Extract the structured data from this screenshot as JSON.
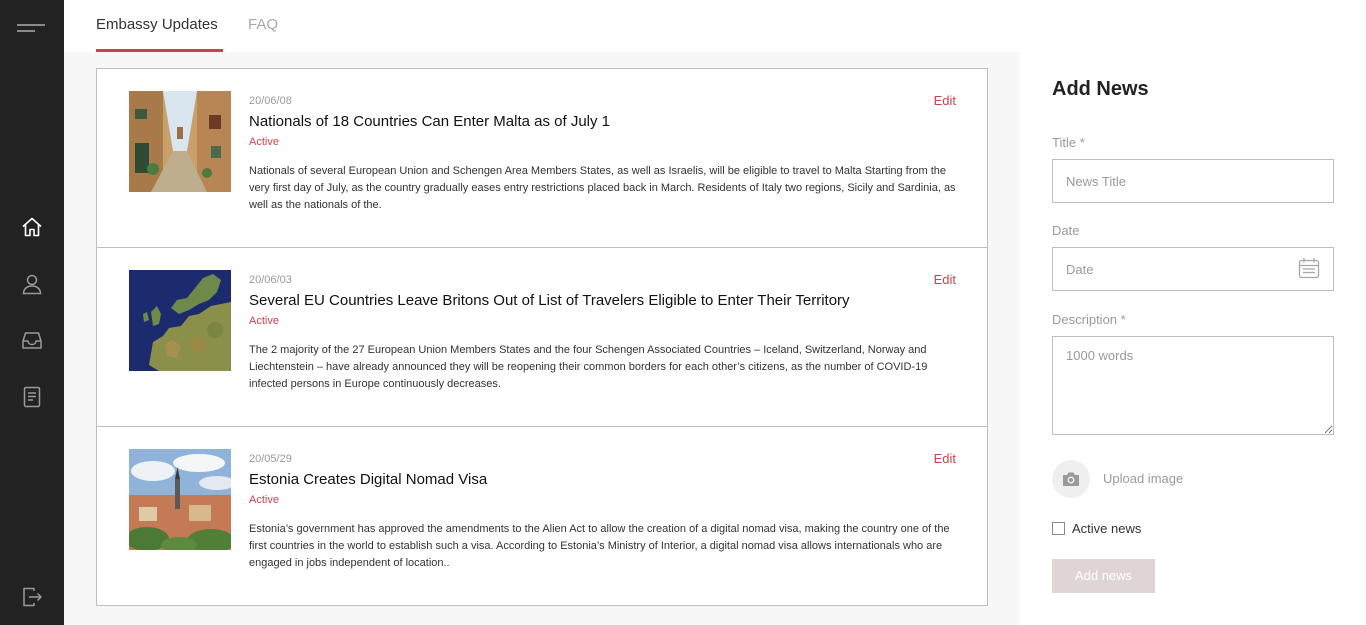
{
  "tabs": [
    {
      "label": "Embassy Updates",
      "active": true
    },
    {
      "label": "FAQ",
      "active": false
    }
  ],
  "sidebar": {
    "icons": [
      "menu-icon",
      "home-icon",
      "user-icon",
      "inbox-icon",
      "document-icon",
      "logout-icon"
    ]
  },
  "news": [
    {
      "date": "20/06/08",
      "title": "Nationals of 18 Countries Can Enter Malta as of July 1",
      "status": "Active",
      "description": "Nationals of several European Union and Schengen Area Members States, as well as Israelis, will be eligible to travel to Malta Starting from the very first day of July, as the country gradually eases entry restrictions placed back in March. Residents of Italy two regions, Sicily and Sardinia, as well as the nationals of the.",
      "edit": "Edit"
    },
    {
      "date": "20/06/03",
      "title": "Several EU Countries Leave Britons Out of List of Travelers Eligible to Enter Their Territory",
      "status": "Active",
      "description": "The 2 majority of the 27 European Union Members States and the four Schengen Associated Countries – Iceland, Switzerland, Norway and Liechtenstein – have already announced they will be reopening their common borders for each other’s citizens, as the number of COVID-19 infected persons in Europe continuously decreases.",
      "edit": "Edit"
    },
    {
      "date": "20/05/29",
      "title": "Estonia Creates Digital Nomad Visa",
      "status": "Active",
      "description": "Estonia’s government has approved the amendments to the Alien Act to allow the creation of a digital nomad visa, making the country one of the first countries in the world to establish such a visa. According to Estonia’s Ministry of Interior, a digital nomad visa allows internationals who are engaged in jobs independent of location..",
      "edit": "Edit"
    }
  ],
  "form": {
    "heading": "Add News",
    "title_label": "Title *",
    "title_placeholder": "News Title",
    "date_label": "Date",
    "date_placeholder": "Date",
    "description_label": "Description *",
    "description_placeholder": "1000 words",
    "upload_label": "Upload image",
    "active_label": "Active news",
    "submit_label": "Add news"
  },
  "colors": {
    "accent": "#c9444f",
    "sidebar": "#222222",
    "button_disabled": "#e0d5d5"
  }
}
